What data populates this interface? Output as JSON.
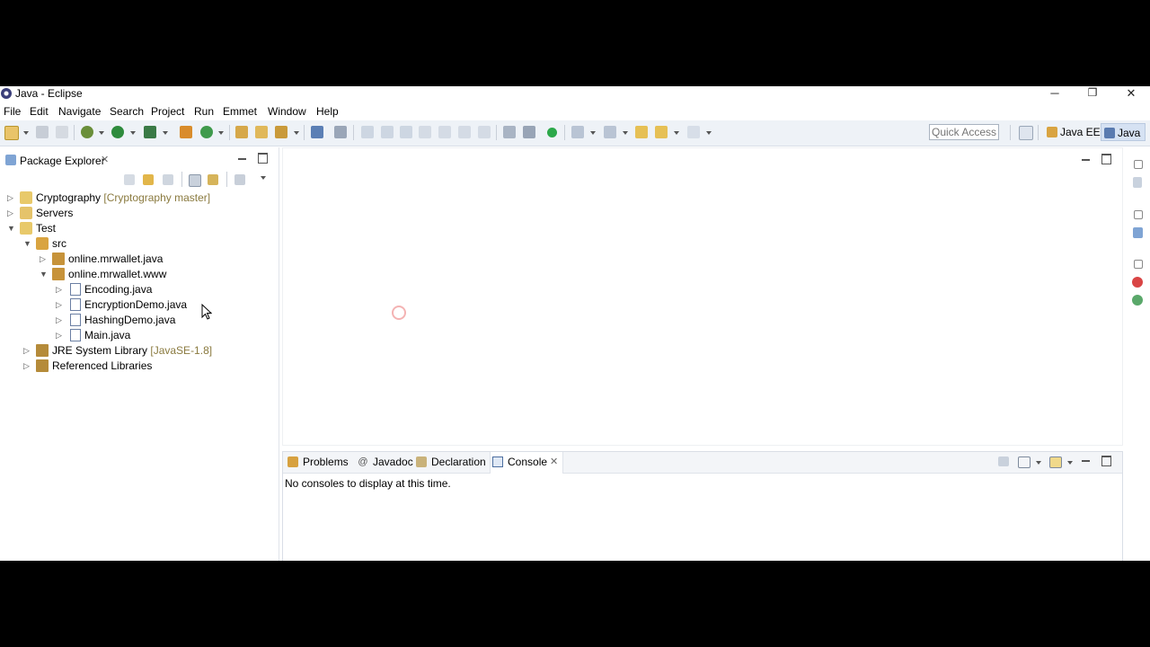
{
  "window": {
    "title": "Java - Eclipse",
    "minimize": "─",
    "restore": "❐",
    "close": "✕"
  },
  "menu": [
    "File",
    "Edit",
    "Navigate",
    "Search",
    "Project",
    "Run",
    "Emmet",
    "Window",
    "Help"
  ],
  "toolbar": {
    "quick_access_placeholder": "Quick Access",
    "perspectives": [
      {
        "label": "Java EE",
        "icon": "java-ee-perspective-icon"
      },
      {
        "label": "Java",
        "icon": "java-perspective-icon",
        "active": true
      }
    ]
  },
  "package_explorer": {
    "tab_label": "Package Explorer",
    "tree": [
      {
        "label": "Cryptography",
        "decoration": "[Cryptography master]",
        "expanded": false,
        "icon": "project-icon"
      },
      {
        "label": "Servers",
        "expanded": false,
        "icon": "folder-icon"
      },
      {
        "label": "Test",
        "expanded": true,
        "icon": "project-icon"
      },
      {
        "label": "src",
        "expanded": true,
        "icon": "source-folder-icon"
      },
      {
        "label": "online.mrwallet.java",
        "expanded": false,
        "icon": "package-icon"
      },
      {
        "label": "online.mrwallet.www",
        "expanded": true,
        "icon": "package-icon"
      },
      {
        "label": "Encoding.java",
        "expanded": false,
        "icon": "java-file-icon"
      },
      {
        "label": "EncryptionDemo.java",
        "expanded": false,
        "icon": "java-file-icon"
      },
      {
        "label": "HashingDemo.java",
        "expanded": false,
        "icon": "java-file-icon"
      },
      {
        "label": "Main.java",
        "expanded": false,
        "icon": "java-file-icon"
      },
      {
        "label": "JRE System Library",
        "decoration": "[JavaSE-1.8]",
        "expanded": false,
        "icon": "library-icon"
      },
      {
        "label": "Referenced Libraries",
        "expanded": false,
        "icon": "library-icon"
      }
    ]
  },
  "bottom_panel": {
    "tabs": [
      "Problems",
      "Javadoc",
      "Declaration",
      "Console"
    ],
    "active_tab": "Console",
    "console_message": "No consoles to display at this time."
  },
  "colors": {
    "toolbar_bg": "#eef2f7",
    "active_perspective_bg": "#d6e2f3",
    "decoration_text": "#8a7a3f"
  }
}
